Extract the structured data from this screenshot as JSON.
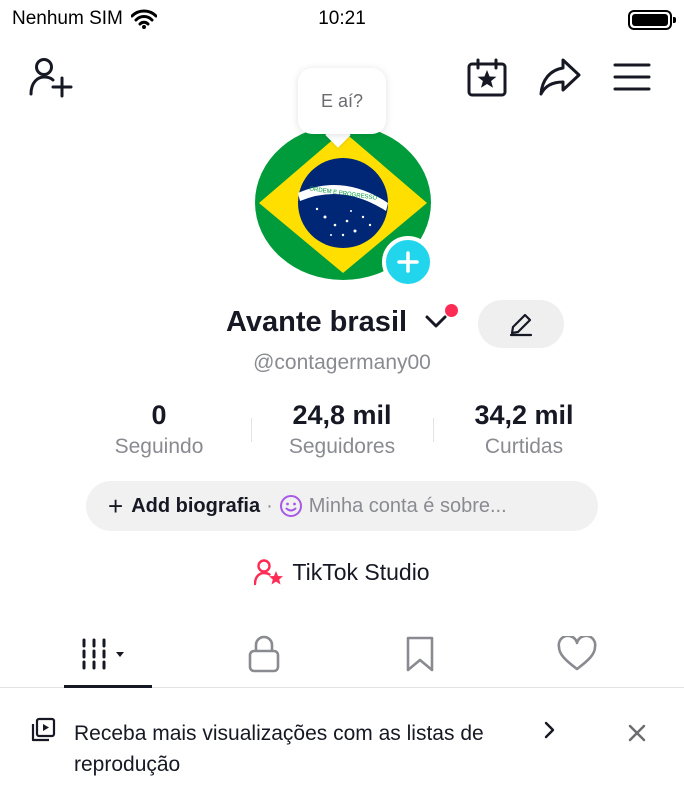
{
  "status_bar": {
    "carrier": "Nenhum SIM",
    "time": "10:21"
  },
  "header": {
    "icons": [
      "add-friend-icon",
      "calendar-star-icon",
      "share-icon",
      "menu-icon"
    ]
  },
  "avatar": {
    "bubble_text": "E aí?",
    "flag_motto": "ORDEM E PROGRESSO"
  },
  "profile": {
    "name": "Avante brasil",
    "username": "@contagermany00"
  },
  "stats": [
    {
      "value": "0",
      "label": "Seguindo"
    },
    {
      "value": "24,8 mil",
      "label": "Seguidores"
    },
    {
      "value": "34,2 mil",
      "label": "Curtidas"
    }
  ],
  "bio": {
    "add_label": "Add biografia",
    "separator": "·",
    "placeholder": "Minha conta é sobre..."
  },
  "studio": {
    "label": "TikTok Studio"
  },
  "tabs": [
    "videos-grid-icon",
    "lock-icon",
    "bookmark-icon",
    "heart-icon"
  ],
  "banner": {
    "text": "Receba mais visualizações com as listas de reprodução"
  },
  "colors": {
    "accent_red": "#fe2c55",
    "accent_cyan": "#20d5ec",
    "text_primary": "#161823",
    "text_secondary": "#8a8b91",
    "flag_green": "#009c3b",
    "flag_yellow": "#ffdf00",
    "flag_blue": "#002776"
  }
}
